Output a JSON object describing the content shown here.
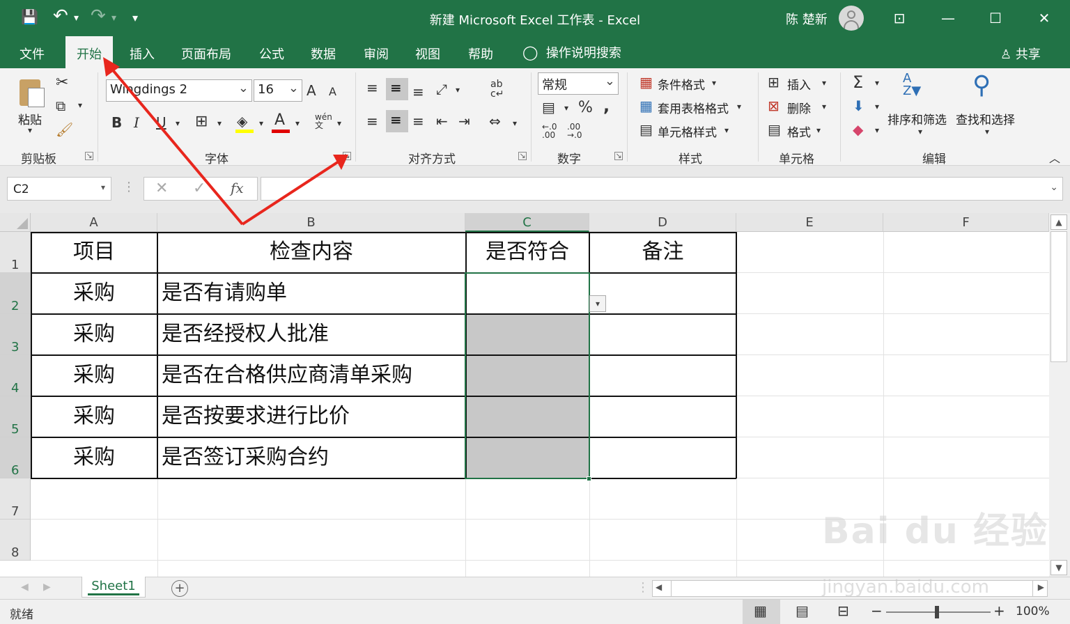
{
  "window": {
    "title": "新建 Microsoft Excel 工作表  -  Excel",
    "user": "陈 楚新",
    "controls": {
      "restore_ribbon": "⊡",
      "minimize": "—",
      "maximize": "☐",
      "close": "✕"
    }
  },
  "quick_access": {
    "save": "💾",
    "undo": "↶",
    "redo": "↷",
    "customize": "▾"
  },
  "tabs": [
    "文件",
    "开始",
    "插入",
    "页面布局",
    "公式",
    "数据",
    "审阅",
    "视图",
    "帮助"
  ],
  "active_tab": "开始",
  "tell_me": "操作说明搜索",
  "share": "共享",
  "ribbon": {
    "clipboard": {
      "label": "剪贴板",
      "paste": "粘贴"
    },
    "font": {
      "label": "字体",
      "font_name": "Wingdings 2",
      "font_size": "16",
      "bold": "B",
      "italic": "I",
      "underline": "U",
      "grow": "A",
      "shrink": "A",
      "phonetic": "wén"
    },
    "alignment": {
      "label": "对齐方式"
    },
    "number": {
      "label": "数字",
      "format": "常规",
      "percent": "%",
      "comma": ","
    },
    "styles": {
      "label": "样式",
      "conditional": "条件格式",
      "table": "套用表格格式",
      "cell_styles": "单元格样式"
    },
    "cells": {
      "label": "单元格",
      "insert": "插入",
      "delete": "删除",
      "format": "格式"
    },
    "editing": {
      "label": "编辑",
      "sort_filter": "排序和筛选",
      "find_select": "查找和选择",
      "sum": "Σ"
    }
  },
  "formula_bar": {
    "name_box": "C2",
    "fx": "fx",
    "formula": ""
  },
  "grid": {
    "columns": [
      "A",
      "B",
      "C",
      "D",
      "E",
      "F"
    ],
    "rows": [
      "1",
      "2",
      "3",
      "4",
      "5",
      "6",
      "7",
      "8"
    ],
    "selected_cell": "C2",
    "header_row": [
      "项目",
      "检查内容",
      "是否符合",
      "备注"
    ],
    "data_rows": [
      [
        "采购",
        "是否有请购单",
        "",
        ""
      ],
      [
        "采购",
        "是否经授权人批准",
        "",
        ""
      ],
      [
        "采购",
        "是否在合格供应商清单采购",
        "",
        ""
      ],
      [
        "采购",
        "是否按要求进行比价",
        "",
        ""
      ],
      [
        "采购",
        "是否签订采购合约",
        "",
        ""
      ]
    ]
  },
  "sheet_tabs": [
    "Sheet1"
  ],
  "status": {
    "ready": "就绪",
    "zoom": "100%",
    "minus": "−",
    "plus": "+"
  },
  "watermark": {
    "brand": "Bai du 经验",
    "url": "jingyan.baidu.com"
  },
  "colors": {
    "excel_green": "#217346",
    "annotation_red": "#e8261d",
    "selection_fill": "#c8c8c8"
  }
}
